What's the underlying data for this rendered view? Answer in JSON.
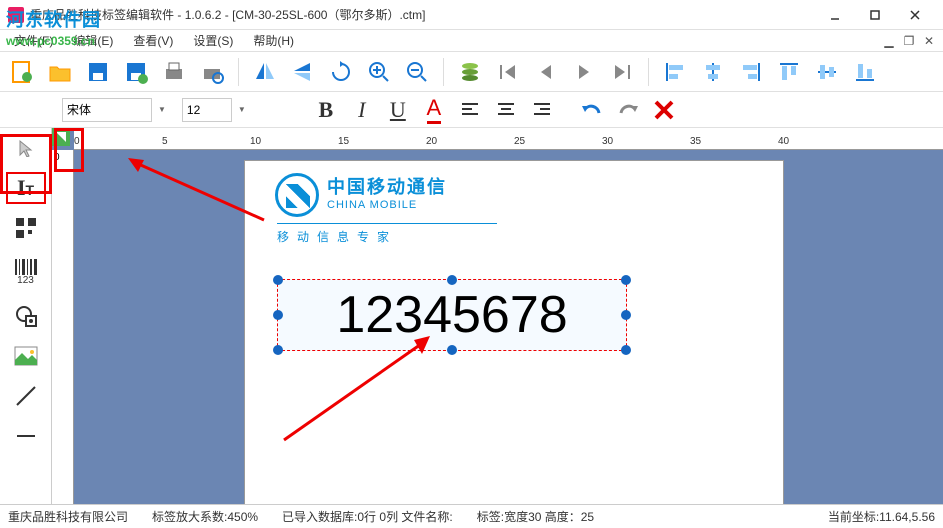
{
  "window": {
    "app_name": "重庆品胜科技标签编辑软件",
    "version": "1.0.6.2",
    "document": "[CM-30-25SL-600（鄂尔多斯）.ctm]",
    "title_sep": " - "
  },
  "watermark": {
    "text": "河东软件园",
    "url": "www.pc0359.cn"
  },
  "menu": {
    "file": "文件(F)",
    "edit": "编辑(E)",
    "view": "查看(V)",
    "settings": "设置(S)",
    "help": "帮助(H)"
  },
  "font": {
    "family": "宋体",
    "size": "12"
  },
  "ruler": {
    "h_ticks": [
      "0",
      "5",
      "10",
      "15",
      "20",
      "25",
      "30",
      "35",
      "40"
    ]
  },
  "label_content": {
    "logo_cn": "中国移动通信",
    "logo_en": "CHINA MOBILE",
    "logo_sub": "移动信息专家",
    "main_text": "12345678"
  },
  "side_tools": {
    "barcode_label": "123"
  },
  "status": {
    "company": "重庆品胜科技有限公司",
    "zoom": "标签放大系数:450%",
    "db_info": "已导入数据库:0行 0列 文件名称:",
    "label_size": "标签:宽度30 高度：25",
    "coords_label": "当前坐标:",
    "coords_value": "11.64,5.56"
  },
  "colors": {
    "accent": "#0a8fd8",
    "canvas_bg": "#6b86b3",
    "selection": "#e00",
    "handle": "#1565c0"
  }
}
